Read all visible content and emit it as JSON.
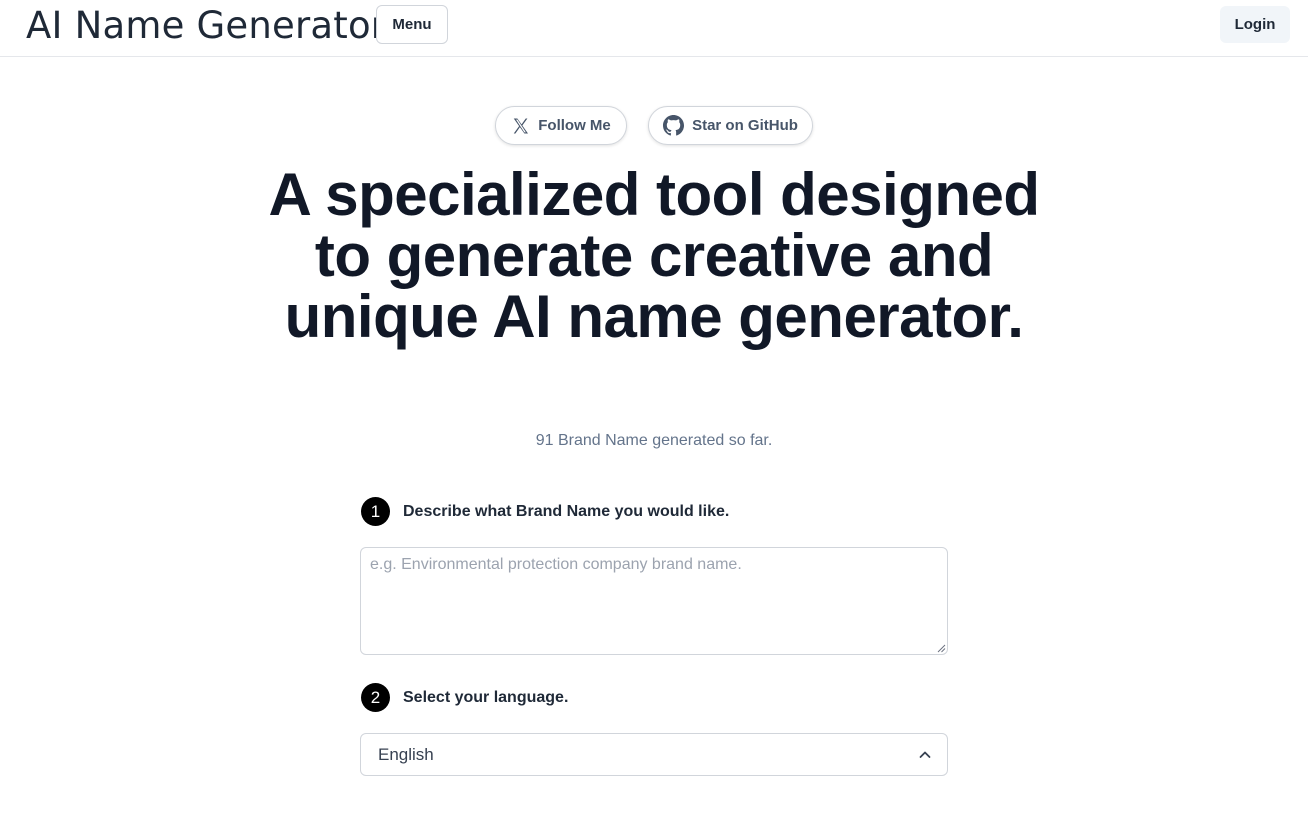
{
  "header": {
    "brand": "AI Name Generator",
    "menu_label": "Menu",
    "login_label": "Login"
  },
  "social": {
    "follow_label": "Follow Me",
    "follow_icon": "x-logo-icon",
    "github_label": "Star on GitHub",
    "github_icon": "github-icon"
  },
  "hero": {
    "headline": "A specialized tool designed to generate creative and unique AI name generator.",
    "counter": "91 Brand Name generated so far."
  },
  "steps": [
    {
      "number": "1",
      "label": "Describe what Brand Name you would like."
    },
    {
      "number": "2",
      "label": "Select your language."
    }
  ],
  "form": {
    "description_placeholder": "e.g. Environmental protection company brand name.",
    "description_value": "",
    "language_selected": "English"
  }
}
